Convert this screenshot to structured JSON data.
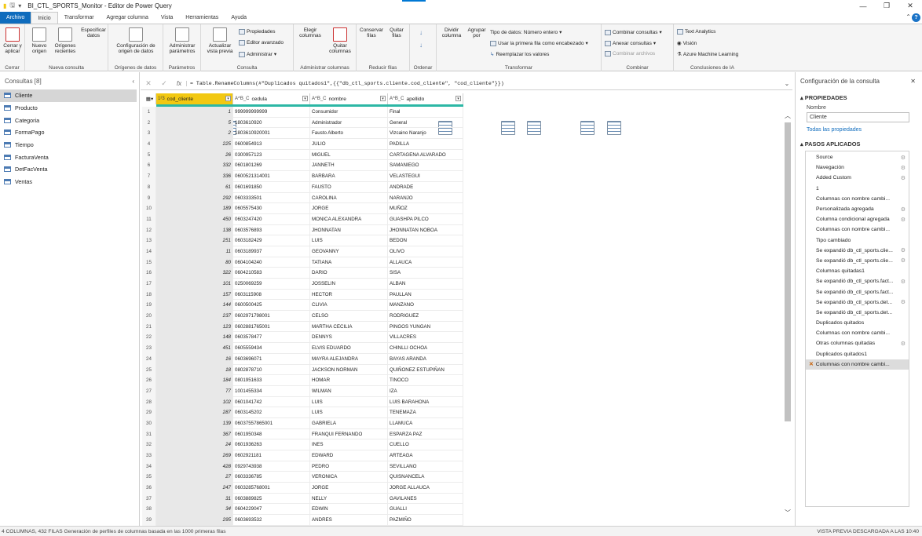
{
  "window": {
    "title": "BI_CTL_SPORTS_Monitor - Editor de Power Query"
  },
  "tabs": [
    "Archivo",
    "Inicio",
    "Transformar",
    "Agregar columna",
    "Vista",
    "Herramientas",
    "Ayuda"
  ],
  "ribbon": {
    "cerrar": {
      "btn": "Cerrar y aplicar",
      "label": "Cerrar"
    },
    "nueva_consulta": {
      "nuevo": "Nuevo origen",
      "recientes": "Orígenes recientes",
      "especificar": "Especificar datos",
      "label": "Nueva consulta"
    },
    "origenes": {
      "config": "Configuración de origen de datos",
      "label": "Orígenes de datos"
    },
    "parametros": {
      "admin": "Administrar parámetros",
      "label": "Parámetros"
    },
    "consulta": {
      "actualizar": "Actualizar vista previa",
      "propiedades": "Propiedades",
      "editor": "Editor avanzado",
      "administrar": "Administrar",
      "label": "Consulta"
    },
    "admin_columnas": {
      "elegir": "Elegir columnas",
      "quitar": "Quitar columnas",
      "label": "Administrar columnas"
    },
    "reducir": {
      "conservar": "Conservar filas",
      "quitar": "Quitar filas",
      "label": "Reducir filas"
    },
    "ordenar": {
      "label": "Ordenar"
    },
    "transformar": {
      "dividir": "Dividir columna",
      "agrupar": "Agrupar por",
      "tipo": "Tipo de datos: Número entero",
      "primera": "Usar la primera fila como encabezado",
      "reemplazar": "Reemplazar los valores",
      "label": "Transformar"
    },
    "combinar": {
      "combinar": "Combinar consultas",
      "anexar": "Anexar consultas",
      "archivos": "Combinar archivos",
      "label": "Combinar"
    },
    "ia": {
      "text": "Text Analytics",
      "vision": "Visión",
      "azure": "Azure Machine Learning",
      "label": "Conclusiones de IA"
    }
  },
  "queries": {
    "header": "Consultas [8]",
    "items": [
      "Cliente",
      "Producto",
      "Categoria",
      "FormaPago",
      "Tiempo",
      "FacturaVenta",
      "DetFacVenta",
      "Ventas"
    ]
  },
  "formula": "= Table.RenameColumns(#\"Duplicados quitados1\",{{\"db_ctl_sports.cliente.cod_cliente\", \"cod_cliente\"}})",
  "table": {
    "columns": [
      {
        "name": "cod_cliente",
        "type": "1²3"
      },
      {
        "name": "cedula",
        "type": "A^B_C"
      },
      {
        "name": "nombre",
        "type": "A^B_C"
      },
      {
        "name": "apellido",
        "type": "A^B_C"
      }
    ],
    "rows": [
      [
        "1",
        "1",
        "999999999999",
        "Consumidor",
        "Final"
      ],
      [
        "2",
        "5",
        "1803610920",
        "Administrador",
        "General"
      ],
      [
        "3",
        "2",
        "1803610920001",
        "Fausto Alberto",
        "Vizcaino Naranjo"
      ],
      [
        "4",
        "225",
        "0600854913",
        "JULIO",
        "PADILLA"
      ],
      [
        "5",
        "26",
        "0300957123",
        "MIGUEL",
        "CARTAGENA ALVARADO"
      ],
      [
        "6",
        "332",
        "0601801269",
        "JANNETH",
        "SAMANIEGO"
      ],
      [
        "7",
        "336",
        "0600521314001",
        "BARBARA",
        "VELASTEGUI"
      ],
      [
        "8",
        "61",
        "0601691850",
        "FAUSTO",
        "ANDRADE"
      ],
      [
        "9",
        "292",
        "0603333501",
        "CAROLINA",
        "NARANJO"
      ],
      [
        "10",
        "189",
        "0605575430",
        "JORGE",
        "MUÑOZ"
      ],
      [
        "11",
        "450",
        "0603247420",
        "MONICA ALEXANDRA",
        "GUASHPA PILCO"
      ],
      [
        "12",
        "138",
        "0603576893",
        "JHONNATAN",
        "JHONNATAN NOBOA"
      ],
      [
        "13",
        "251",
        "0603182429",
        "LUIS",
        "BEDON"
      ],
      [
        "14",
        "11",
        "0603189937",
        "GEOVANNY",
        "OLIVO"
      ],
      [
        "15",
        "80",
        "0604104240",
        "TATIANA",
        "ALLAUCA"
      ],
      [
        "16",
        "322",
        "0604210583",
        "DARIO",
        "SISA"
      ],
      [
        "17",
        "101",
        "0250069259",
        "JOSSELIN",
        "ALBAN"
      ],
      [
        "18",
        "157",
        "0603115908",
        "HECTOR",
        "PAULLAN"
      ],
      [
        "19",
        "144",
        "0600500425",
        "CLIVIA",
        "MANZANO"
      ],
      [
        "20",
        "237",
        "0602971798001",
        "CELSO",
        "RODRIGUEZ"
      ],
      [
        "21",
        "123",
        "0602881765001",
        "MARTHA CECILIA",
        "PINGOS YUNGAN"
      ],
      [
        "22",
        "148",
        "0603578477",
        "DENNYS",
        "VILLACRES"
      ],
      [
        "23",
        "451",
        "0605559434",
        "ELVIS EDUARDO",
        "CHINLLI OCHOA"
      ],
      [
        "24",
        "16",
        "0603696071",
        "MAYRA ALEJANDRA",
        "BAYAS ARANDA"
      ],
      [
        "25",
        "18",
        "0802878710",
        "JACKSON NORMAN",
        "QUIÑONEZ ESTUPIÑAN"
      ],
      [
        "26",
        "184",
        "0801951633",
        "HOMAR",
        "TINOCO"
      ],
      [
        "27",
        "77",
        "1001455334",
        "WILMAN",
        "IZA"
      ],
      [
        "28",
        "102",
        "0601041742",
        "LUIS",
        "LUIS BARAHONA"
      ],
      [
        "29",
        "287",
        "0603145202",
        "LUIS",
        "TENEMAZA"
      ],
      [
        "30",
        "139",
        "06037557865001",
        "GABRIELA",
        "LLAMUCA"
      ],
      [
        "31",
        "367",
        "0601950348",
        "FRANQUI FERNANDO",
        "ESPARZA PAZ"
      ],
      [
        "32",
        "24",
        "0601936263",
        "INES",
        "CUELLO"
      ],
      [
        "33",
        "269",
        "0602921181",
        "EDWARD",
        "ARTEAGA"
      ],
      [
        "34",
        "428",
        "0929743938",
        "PEDRO",
        "SEVILLANO"
      ],
      [
        "35",
        "27",
        "0603336785",
        "VERONICA",
        "QUISNANCELA"
      ],
      [
        "36",
        "247",
        "0603285768001",
        "JORGE",
        "JORGE ALLAUCA"
      ],
      [
        "37",
        "31",
        "0603889825",
        "NELLY",
        "GAVILANES"
      ],
      [
        "38",
        "34",
        "0604229047",
        "EDWIN",
        "GUALLI"
      ],
      [
        "39",
        "295",
        "0603693532",
        "ANDRES",
        "PAZMIÑO"
      ]
    ]
  },
  "settings": {
    "header": "Configuración de la consulta",
    "properties_title": "PROPIEDADES",
    "name_label": "Nombre",
    "name_value": "Cliente",
    "all_props_link": "Todas las propiedades",
    "steps_title": "PASOS APLICADOS",
    "steps": [
      {
        "label": "Source",
        "gear": true
      },
      {
        "label": "Navegación",
        "gear": true
      },
      {
        "label": "Added Custom",
        "gear": true
      },
      {
        "label": "1",
        "gear": false
      },
      {
        "label": "Columnas con nombre cambi...",
        "gear": false
      },
      {
        "label": "Personalizada agregada",
        "gear": true
      },
      {
        "label": "Columna condicional agregada",
        "gear": true
      },
      {
        "label": "Columnas con nombre cambi...",
        "gear": false
      },
      {
        "label": "Tipo cambiado",
        "gear": false
      },
      {
        "label": "Se expandió db_ctl_sports.clie...",
        "gear": true
      },
      {
        "label": "Se expandió db_ctl_sports.clie...",
        "gear": true
      },
      {
        "label": "Columnas quitadas1",
        "gear": false
      },
      {
        "label": "Se expandió db_ctl_sports.fact...",
        "gear": true
      },
      {
        "label": "Se expandió db_ctl_sports.fact...",
        "gear": false
      },
      {
        "label": "Se expandió db_ctl_sports.det...",
        "gear": true
      },
      {
        "label": "Se expandió db_ctl_sports.det...",
        "gear": false
      },
      {
        "label": "Duplicados quitados",
        "gear": false
      },
      {
        "label": "Columnas con nombre cambi...",
        "gear": false
      },
      {
        "label": "Otras columnas quitadas",
        "gear": true
      },
      {
        "label": "Duplicados quitados1",
        "gear": false
      },
      {
        "label": "Columnas con nombre cambi...",
        "gear": false,
        "selected": true
      }
    ]
  },
  "status": {
    "left": "4 COLUMNAS, 432 FILAS    Generación de perfiles de columnas basada en las 1000 primeras filas",
    "right": "VISTA PREVIA DESCARGADA A LAS 10:40"
  }
}
